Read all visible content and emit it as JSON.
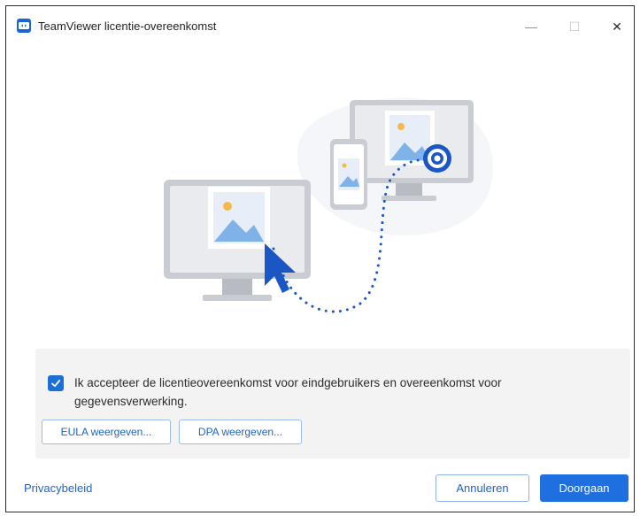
{
  "window": {
    "title": "TeamViewer licentie-overeenkomst",
    "controls": {
      "minimize": "—",
      "maximize": "☐",
      "close": "✕"
    }
  },
  "illustration": {
    "icons": [
      "monitor-icon",
      "smartphone-icon",
      "cursor-icon",
      "target-icon",
      "image-icon"
    ]
  },
  "agreement": {
    "checked": true,
    "text": "Ik accepteer de licentieovereenkomst voor eindgebruikers en overeenkomst voor gegevensverwerking.",
    "eula_button": "EULA weergeven...",
    "dpa_button": "DPA weergeven..."
  },
  "footer": {
    "privacy_link": "Privacybeleid",
    "cancel_button": "Annuleren",
    "continue_button": "Doorgaan"
  },
  "colors": {
    "accent": "#1f6fe0",
    "link": "#1f63c6",
    "panel_bg": "#f3f3f3"
  }
}
